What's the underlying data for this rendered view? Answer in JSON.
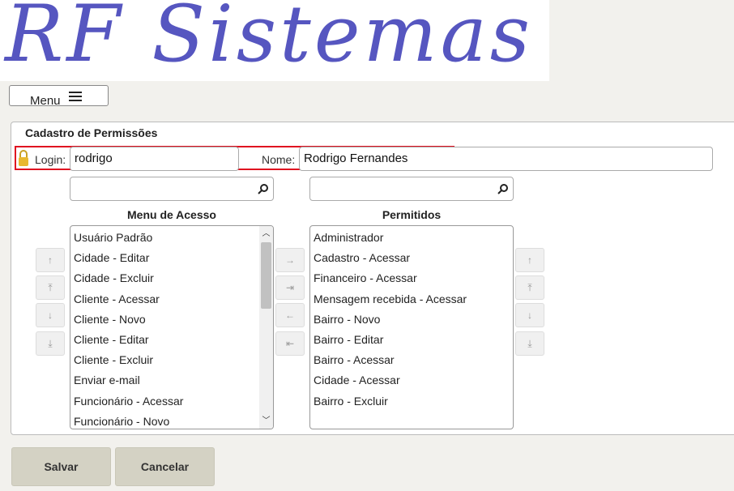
{
  "logo": {
    "text": "RF Sistemas"
  },
  "menu": {
    "label": "Menu"
  },
  "form": {
    "title": "Cadastro de Permissões",
    "login_label": "Login:",
    "login_value": "rodrigo",
    "nome_label": "Nome:",
    "nome_value": "Rodrigo Fernandes"
  },
  "lists": {
    "menu_title": "Menu de Acesso",
    "allowed_title": "Permitidos",
    "menu_items": [
      "Usuário Padrão",
      "Cidade - Editar",
      "Cidade - Excluir",
      "Cliente - Acessar",
      "Cliente - Novo",
      "Cliente - Editar",
      "Cliente - Excluir",
      "Enviar e-mail",
      "Funcionário - Acessar",
      "Funcionário - Novo"
    ],
    "allowed_items": [
      "Administrador",
      "Cadastro - Acessar",
      "Financeiro - Acessar",
      "Mensagem recebida - Acessar",
      "Bairro - Novo",
      "Bairro - Editar",
      "Bairro - Acessar",
      "Cidade - Acessar",
      "Bairro - Excluir"
    ]
  },
  "controls": {
    "order_left": [
      "↑",
      "⤒",
      "↓",
      "⤓"
    ],
    "transfer": [
      "→",
      "⇥",
      "←",
      "⇤"
    ],
    "order_right": [
      "↑",
      "⤒",
      "↓",
      "⤓"
    ]
  },
  "buttons": {
    "save": "Salvar",
    "cancel": "Cancelar"
  },
  "colors": {
    "logo": "#5656c0",
    "highlight": "#e01020",
    "button_bg": "#d4d2c4"
  }
}
